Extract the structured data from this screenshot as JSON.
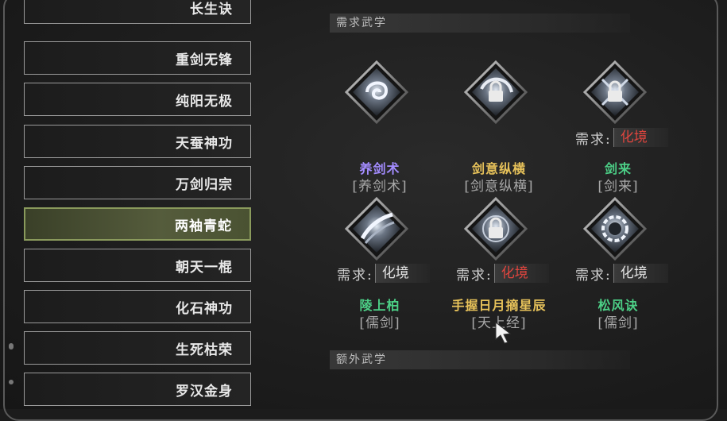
{
  "colors": {
    "purple": "#a38cff",
    "gold": "#e7c25a",
    "green": "#4ccf86",
    "red": "#e0453e"
  },
  "sidebar": {
    "items": [
      {
        "label": "长生诀"
      },
      {
        "label": "重剑无锋"
      },
      {
        "label": "纯阳无极"
      },
      {
        "label": "天蚕神功"
      },
      {
        "label": "万剑归宗"
      },
      {
        "label": "两袖青蛇"
      },
      {
        "label": "朝天一棍"
      },
      {
        "label": "化石神功"
      },
      {
        "label": "生死枯荣"
      },
      {
        "label": "罗汉金身"
      }
    ],
    "selected": "两袖青蛇"
  },
  "sections": {
    "required": "需求武学",
    "extra": "额外武学"
  },
  "requirement_prefix": "需求:",
  "skills": [
    {
      "name": "养剑术",
      "sub": "[养剑术]",
      "name_color": "purple",
      "icon": "swirl-icon",
      "requirement": null
    },
    {
      "name": "剑意纵横",
      "sub": "[剑意纵横]",
      "name_color": "gold",
      "icon": "locked-swirl-icon",
      "requirement": null
    },
    {
      "name": "剑来",
      "sub": "[剑来]",
      "name_color": "green",
      "icon": "locked-sword-icon",
      "requirement": {
        "value": "化境",
        "color": "red"
      }
    },
    {
      "name": "陵上柏",
      "sub": "[儒剑]",
      "name_color": "green",
      "icon": "slash-icon",
      "requirement": {
        "value": "化境",
        "color": "white"
      }
    },
    {
      "name": "手握日月摘星辰",
      "sub": "[天上经]",
      "name_color": "gold",
      "icon": "locked-orb-icon",
      "requirement": {
        "value": "化境",
        "color": "red"
      }
    },
    {
      "name": "松风诀",
      "sub": "[儒剑]",
      "name_color": "green",
      "icon": "ring-icon",
      "requirement": {
        "value": "化境",
        "color": "white"
      }
    }
  ]
}
